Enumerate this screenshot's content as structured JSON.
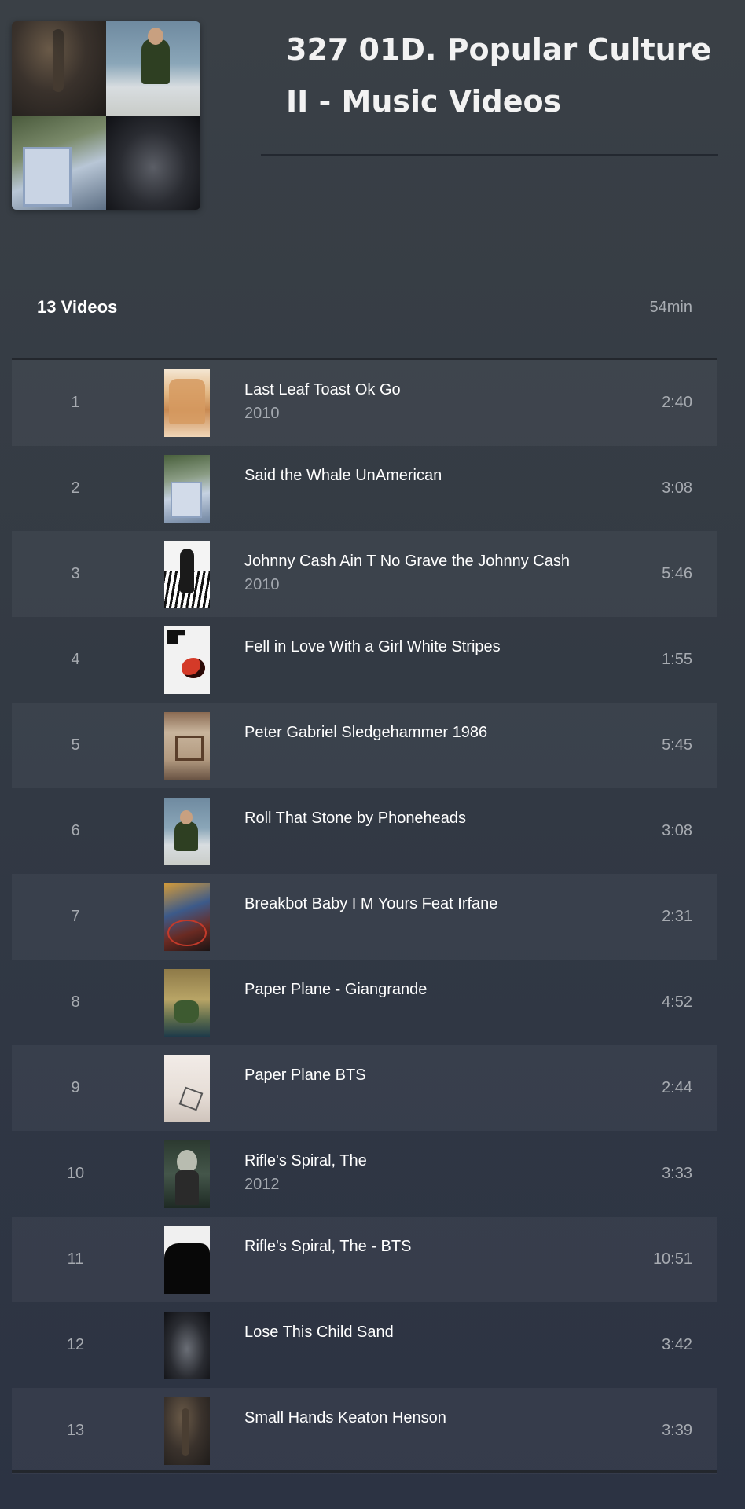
{
  "playlist": {
    "title": "327 01D. Popular Culture II - Music Videos",
    "video_count": "13 Videos",
    "total_duration": "54min"
  },
  "videos": [
    {
      "num": "1",
      "title": "Last Leaf Toast Ok Go",
      "year": "2010",
      "duration": "2:40"
    },
    {
      "num": "2",
      "title": "Said the Whale UnAmerican",
      "year": "",
      "duration": "3:08"
    },
    {
      "num": "3",
      "title": "Johnny Cash Ain T No Grave the Johnny Cash",
      "year": "2010",
      "duration": "5:46"
    },
    {
      "num": "4",
      "title": "Fell in Love With a Girl White Stripes",
      "year": "",
      "duration": "1:55"
    },
    {
      "num": "5",
      "title": "Peter Gabriel Sledgehammer 1986",
      "year": "",
      "duration": "5:45"
    },
    {
      "num": "6",
      "title": "Roll That Stone by Phoneheads",
      "year": "",
      "duration": "3:08"
    },
    {
      "num": "7",
      "title": "Breakbot Baby I M Yours Feat Irfane",
      "year": "",
      "duration": "2:31"
    },
    {
      "num": "8",
      "title": "Paper Plane - Giangrande",
      "year": "",
      "duration": "4:52"
    },
    {
      "num": "9",
      "title": "Paper Plane BTS",
      "year": "",
      "duration": "2:44"
    },
    {
      "num": "10",
      "title": "Rifle's Spiral, The",
      "year": "2012",
      "duration": "3:33"
    },
    {
      "num": "11",
      "title": "Rifle's Spiral, The - BTS",
      "year": "",
      "duration": "10:51"
    },
    {
      "num": "12",
      "title": "Lose This Child Sand",
      "year": "",
      "duration": "3:42"
    },
    {
      "num": "13",
      "title": "Small Hands Keaton Henson",
      "year": "",
      "duration": "3:39"
    }
  ]
}
